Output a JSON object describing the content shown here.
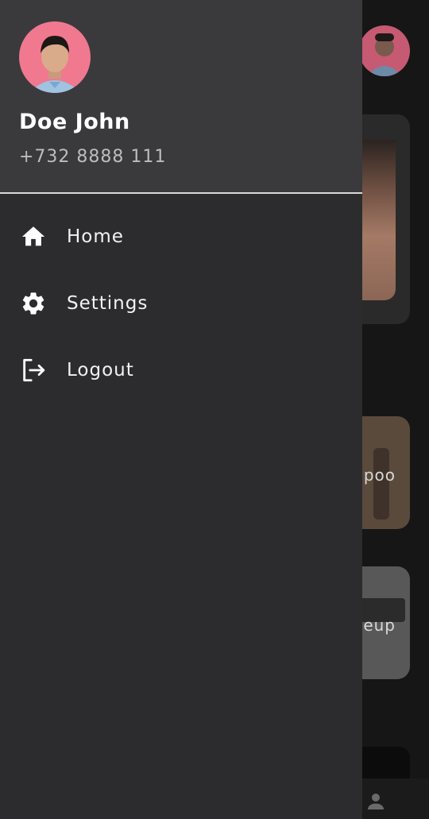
{
  "drawer": {
    "user": {
      "name": "Doe John",
      "phone": "+732 8888 111"
    },
    "menu": [
      {
        "label": "Home",
        "icon": "home-icon"
      },
      {
        "label": "Settings",
        "icon": "gear-icon"
      },
      {
        "label": "Logout",
        "icon": "logout-icon"
      }
    ]
  },
  "background": {
    "cards": [
      {
        "label": "poo"
      },
      {
        "label": "eup"
      }
    ]
  },
  "colors": {
    "drawer_bg": "#2c2c2e",
    "header_bg": "#3a3a3c",
    "avatar_bg": "#f0798f",
    "text_primary": "#ffffff",
    "text_secondary": "#bdbdbd"
  }
}
